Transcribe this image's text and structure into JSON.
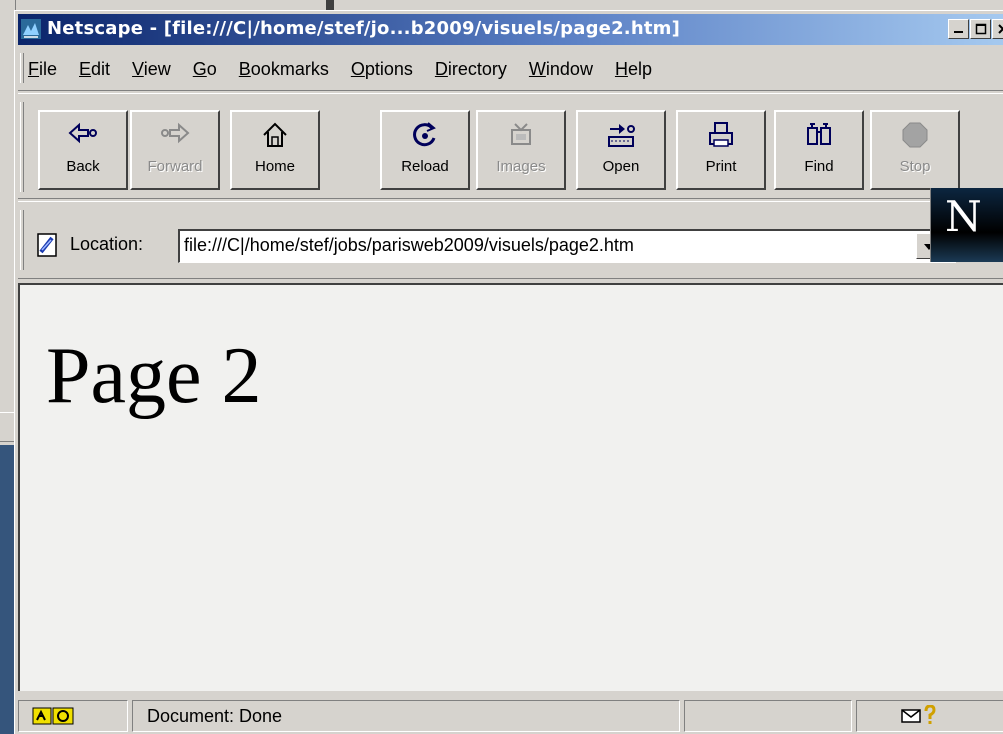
{
  "window": {
    "title": "Netscape - [file:///C|/home/stef/jo...b2009/visuels/page2.htm]"
  },
  "menu": {
    "items": [
      {
        "pre": "",
        "key": "F",
        "post": "ile"
      },
      {
        "pre": "",
        "key": "E",
        "post": "dit"
      },
      {
        "pre": "",
        "key": "V",
        "post": "iew"
      },
      {
        "pre": "",
        "key": "G",
        "post": "o"
      },
      {
        "pre": "",
        "key": "B",
        "post": "ookmarks"
      },
      {
        "pre": "",
        "key": "O",
        "post": "ptions"
      },
      {
        "pre": "",
        "key": "D",
        "post": "irectory"
      },
      {
        "pre": "",
        "key": "W",
        "post": "indow"
      },
      {
        "pre": "",
        "key": "H",
        "post": "elp"
      }
    ]
  },
  "toolbar": {
    "back": "Back",
    "forward": "Forward",
    "home": "Home",
    "reload": "Reload",
    "images": "Images",
    "open": "Open",
    "print": "Print",
    "find": "Find",
    "stop": "Stop"
  },
  "location": {
    "label": "Location:",
    "value": "file:///C|/home/stef/jobs/parisweb2009/visuels/page2.htm"
  },
  "logo": {
    "letter": "N"
  },
  "page": {
    "heading": "Page 2"
  },
  "status": {
    "text": "Document: Done"
  },
  "colors": {
    "titlebar_start": "#0a246a",
    "titlebar_end": "#a6caf0",
    "chrome": "#d6d3ce",
    "content_bg": "#f1f1ef"
  }
}
